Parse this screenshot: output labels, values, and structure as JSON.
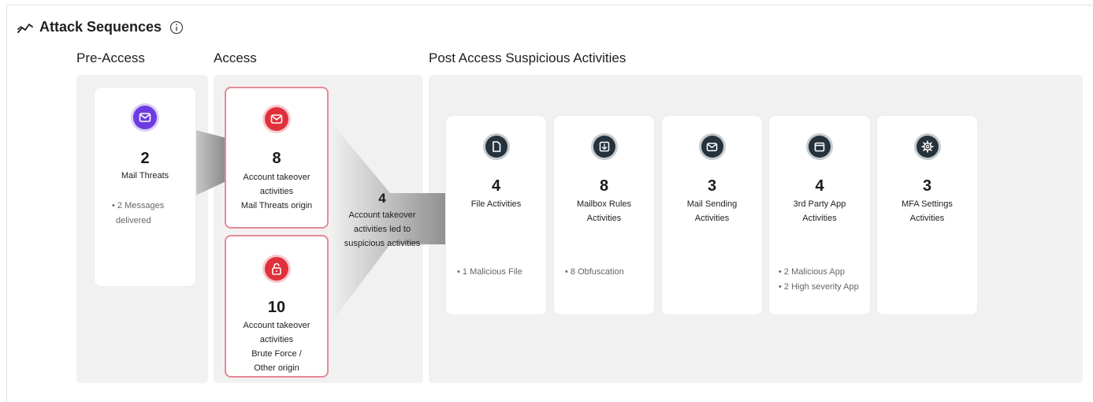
{
  "header": {
    "title": "Attack Sequences",
    "trend_icon": "trend-icon",
    "info_icon": "info-icon"
  },
  "columns": {
    "pre_access": "Pre-Access",
    "access": "Access",
    "post_access": "Post Access Suspicious Activities"
  },
  "pre_access_card": {
    "icon": "mail-icon",
    "count": "2",
    "label": "Mail Threats",
    "bullets": [
      "• 2 Messages",
      "delivered"
    ]
  },
  "access_cards": [
    {
      "icon": "mail-icon",
      "count": "8",
      "lines": [
        "Account takeover",
        "activities",
        "Mail Threats origin"
      ]
    },
    {
      "icon": "unlock-icon",
      "count": "10",
      "lines": [
        "Account takeover",
        "activities",
        "Brute Force /",
        "Other origin"
      ]
    }
  ],
  "funnel": {
    "count": "4",
    "lines": [
      "Account takeover",
      "activities led to",
      "suspicious activities"
    ]
  },
  "post_cards": [
    {
      "icon": "file-icon",
      "count": "4",
      "lines": [
        "File Activities"
      ],
      "bullets": [
        "• 1 Malicious File"
      ]
    },
    {
      "icon": "mailbox-rules-icon",
      "count": "8",
      "lines": [
        "Mailbox Rules",
        "Activities"
      ],
      "bullets": [
        "• 8 Obfuscation"
      ]
    },
    {
      "icon": "mail-icon",
      "count": "3",
      "lines": [
        "Mail Sending",
        "Activities"
      ],
      "bullets": []
    },
    {
      "icon": "app-window-icon",
      "count": "4",
      "lines": [
        "3rd Party App",
        "Activities"
      ],
      "bullets": [
        "• 2 Malicious App",
        "• 2 High severity App"
      ]
    },
    {
      "icon": "gear-icon",
      "count": "3",
      "lines": [
        "MFA Settings",
        "Activities"
      ],
      "bullets": []
    }
  ],
  "colors": {
    "purple": "#6c3ce0",
    "red": "#e0303b",
    "dark": "#26333d",
    "card_border_red": "#e58a97",
    "panel": "#f1f1f1"
  }
}
